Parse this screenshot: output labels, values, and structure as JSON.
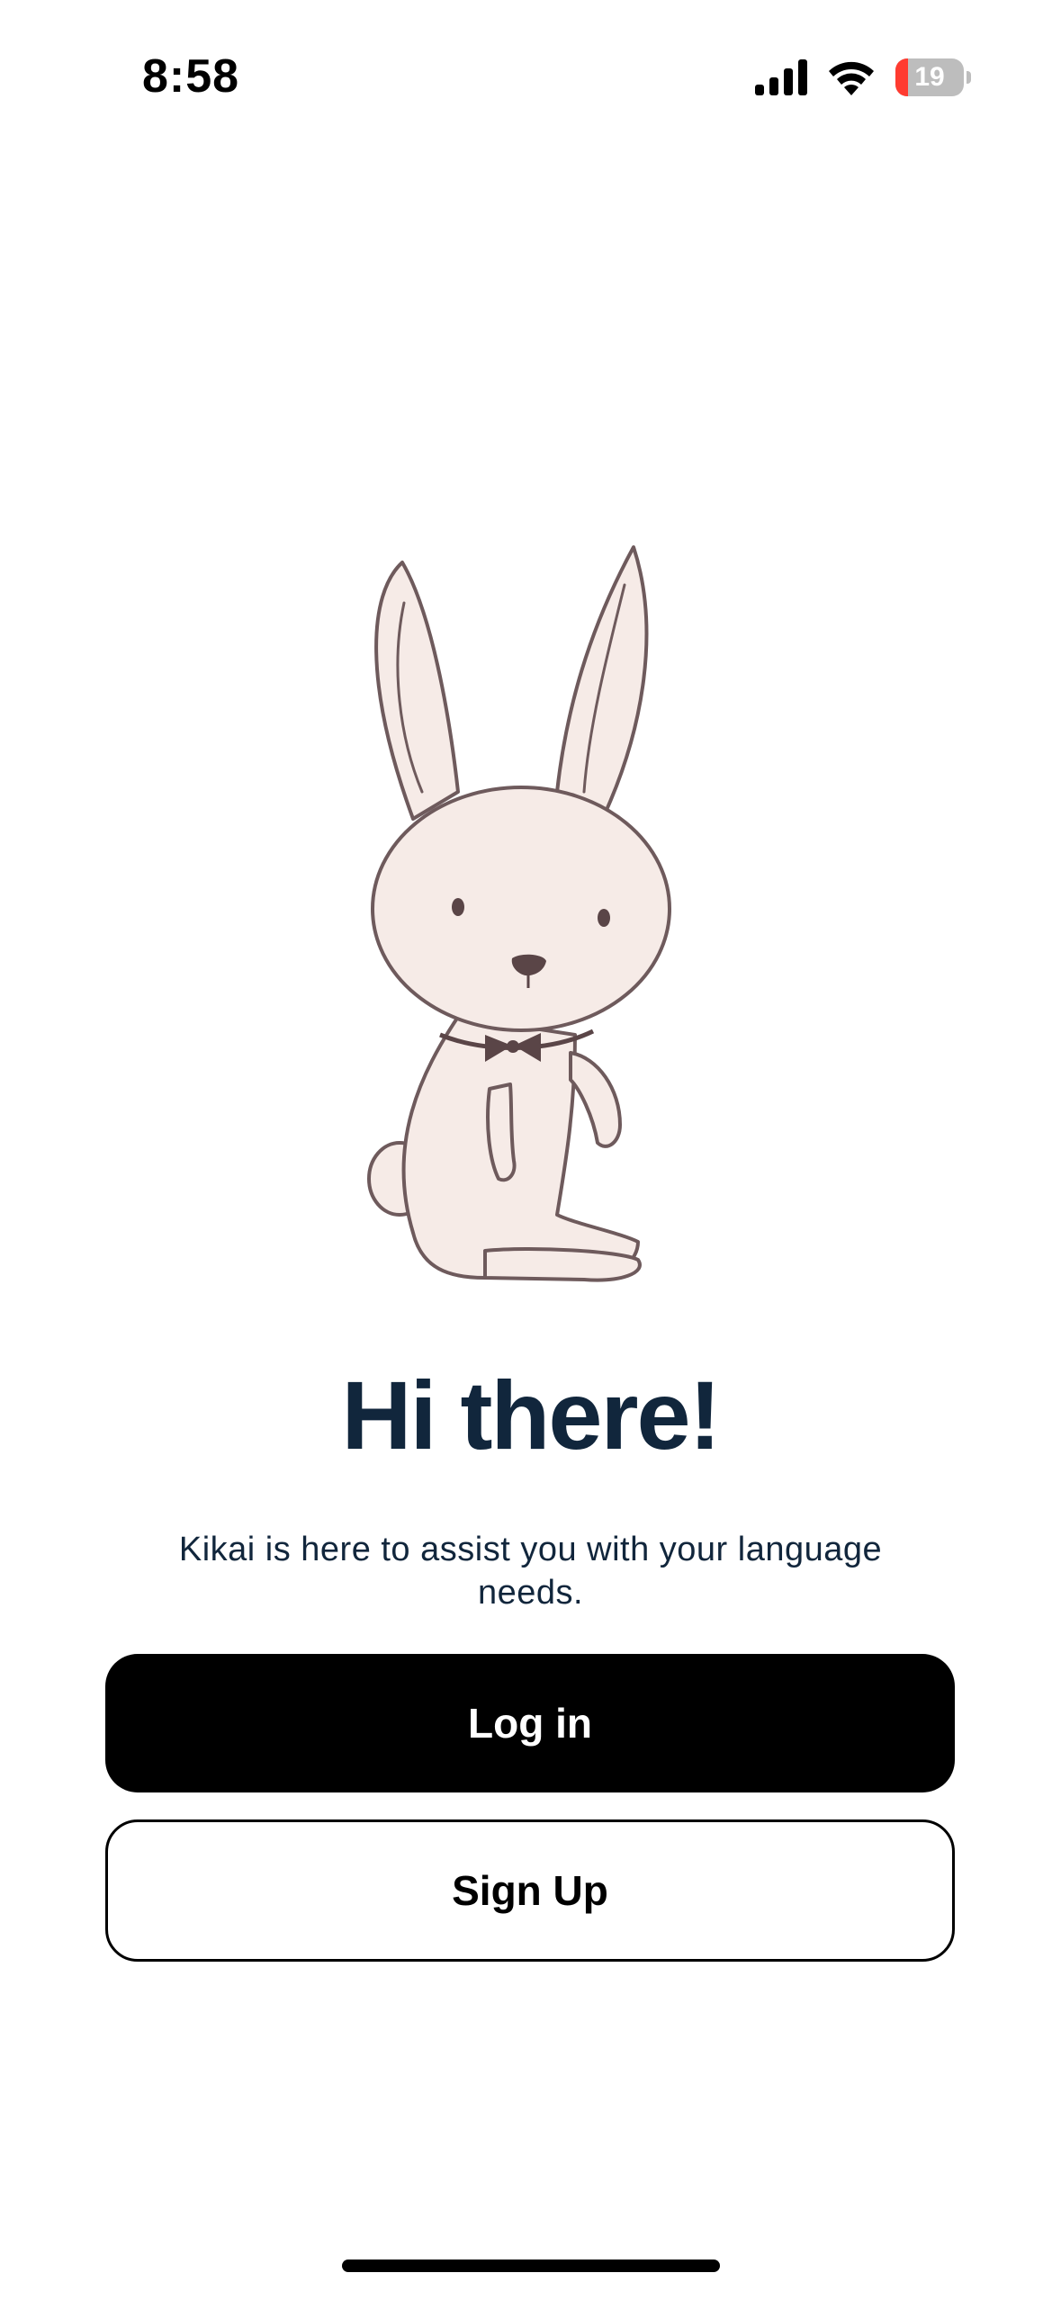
{
  "status_bar": {
    "time": "8:58",
    "battery_level": "19",
    "battery_fraction": 0.19,
    "icons": [
      "cellular-signal-icon",
      "wifi-icon",
      "battery-charging-icon"
    ]
  },
  "welcome": {
    "title": "Hi there!",
    "subtitle": "Kikai is here to assist you with your language needs."
  },
  "actions": {
    "login_label": "Log in",
    "signup_label": "Sign Up"
  },
  "colors": {
    "heading": "#11263c",
    "primary_button": "#000000",
    "battery_low": "#ff3b30",
    "illustration_fill": "#f6ebe7",
    "illustration_stroke": "#6e5a5c"
  }
}
